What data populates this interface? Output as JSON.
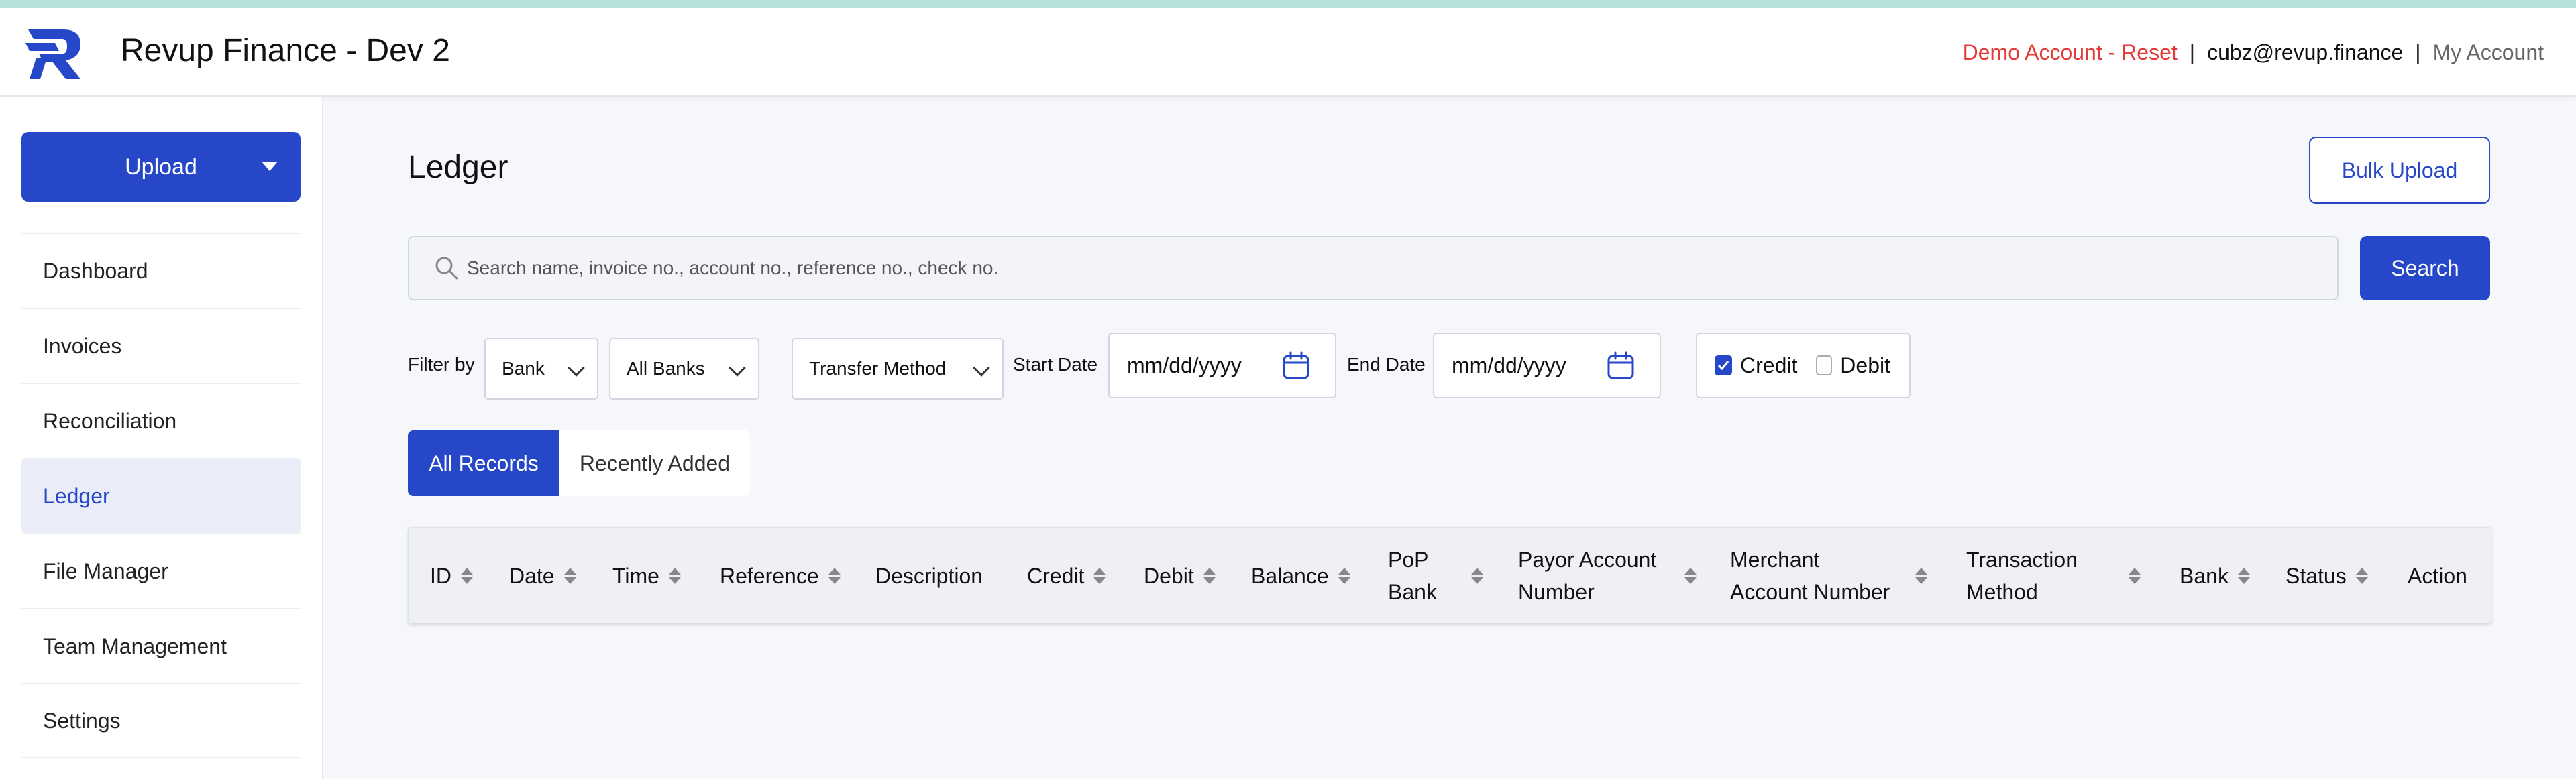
{
  "header": {
    "app_title": "Revup Finance - Dev 2",
    "demo_link": "Demo Account - Reset",
    "separator": "|",
    "email": "cubz@revup.finance",
    "account_link": "My Account"
  },
  "sidebar": {
    "upload_label": "Upload",
    "items": [
      {
        "label": "Dashboard"
      },
      {
        "label": "Invoices"
      },
      {
        "label": "Reconciliation"
      },
      {
        "label": "Ledger"
      },
      {
        "label": "File Manager"
      },
      {
        "label": "Team Management"
      },
      {
        "label": "Settings"
      }
    ],
    "active": "Ledger"
  },
  "page": {
    "title": "Ledger",
    "bulk_upload_label": "Bulk Upload"
  },
  "search": {
    "placeholder": "Search name, invoice no., account no., reference no., check no.",
    "button_label": "Search"
  },
  "filters": {
    "filter_by_label": "Filter by",
    "bank_select": "Bank",
    "all_banks_select": "All Banks",
    "transfer_method_select": "Transfer Method",
    "start_date_label": "Start Date",
    "start_date_value": "mm/dd/yyyy",
    "end_date_label": "End Date",
    "end_date_value": "mm/dd/yyyy",
    "credit_label": "Credit",
    "credit_checked": true,
    "debit_label": "Debit",
    "debit_checked": false
  },
  "tabs": {
    "all_records": "All Records",
    "recently_added": "Recently Added",
    "active": "All Records"
  },
  "table": {
    "columns": [
      {
        "label": "ID",
        "sortable": true
      },
      {
        "label": "Date",
        "sortable": true
      },
      {
        "label": "Time",
        "sortable": true
      },
      {
        "label": "Reference",
        "sortable": true
      },
      {
        "label": "Description",
        "sortable": false
      },
      {
        "label": "Credit",
        "sortable": true
      },
      {
        "label": "Debit",
        "sortable": true
      },
      {
        "label": "Balance",
        "sortable": true
      },
      {
        "label1": "PoP",
        "label2": "Bank",
        "sortable": true
      },
      {
        "label1": "Payor Account",
        "label2": "Number",
        "sortable": true
      },
      {
        "label1": "Merchant",
        "label2": "Account Number",
        "sortable": true
      },
      {
        "label1": "Transaction",
        "label2": "Method",
        "sortable": true
      },
      {
        "label": "Bank",
        "sortable": true
      },
      {
        "label": "Status",
        "sortable": true
      },
      {
        "label": "Action",
        "sortable": false
      }
    ],
    "rows": []
  },
  "colors": {
    "primary": "#2747c9",
    "demo_link": "#e53935",
    "accent_strip": "#b8e3dc"
  },
  "icons": {
    "logo": "revup-logo-icon",
    "search": "search-icon",
    "calendar": "calendar-icon",
    "dropdown": "chevron-down-icon",
    "sort": "sort-icon"
  }
}
